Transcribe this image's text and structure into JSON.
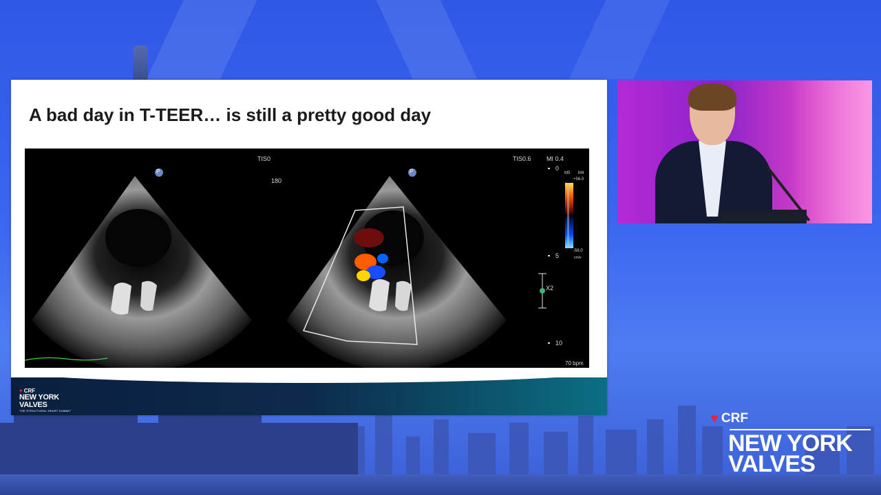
{
  "slide": {
    "title": "A bad day in T-TEER… is still a pretty good day",
    "echo_labels": {
      "tis_left": "TIS0",
      "angle": "180",
      "tis_right": "TIS0.6",
      "mi": "MI 0.4",
      "depth_0": "0",
      "depth_5": "5",
      "depth_10": "10",
      "scale_top": "+56.0",
      "scale_bottom": "-56.0",
      "scale_unit": "cm/s",
      "m5": "M5",
      "m4": "M4",
      "zoom": "X2",
      "heart_rate": "70 bpm",
      "probe_marker": "P"
    },
    "footer_logo": {
      "crf": "CRF",
      "line1": "NEW YORK",
      "line2": "VALVES",
      "sub": "THE STRUCTURAL HEART SUMMIT"
    }
  },
  "brand": {
    "crf": "CRF",
    "line1": "NEW YORK",
    "line2": "VALVES"
  },
  "colors": {
    "background": "#3b66f0",
    "brand_red": "#e8243c",
    "stage_magenta": "#c42fd0"
  }
}
